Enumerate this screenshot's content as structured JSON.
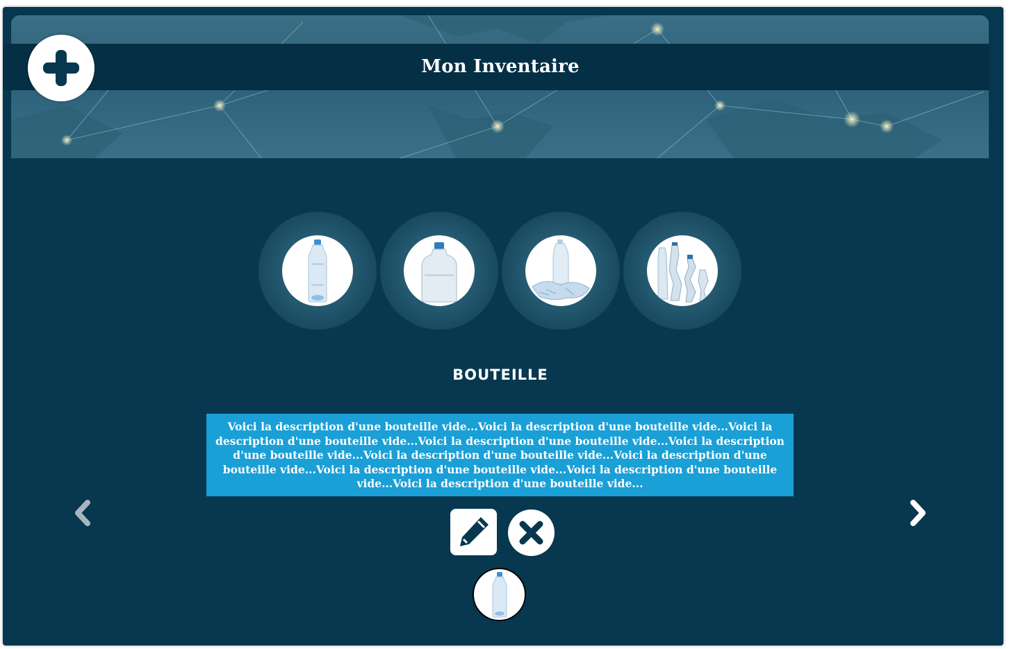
{
  "header": {
    "title": "Mon Inventaire"
  },
  "inventory": {
    "items": [
      {
        "icon": "water-bottle-icon"
      },
      {
        "icon": "large-bottle-icon"
      },
      {
        "icon": "crushed-bottles-icon"
      },
      {
        "icon": "bottle-group-icon"
      }
    ],
    "selected": {
      "name": "BOUTEILLE",
      "description": "Voici la description d'une bouteille vide...Voici la description d'une bouteille vide...Voici la description d'une bouteille vide...Voici la description d'une bouteille vide...Voici la description d'une bouteille vide...Voici la description d'une bouteille vide...Voici la description d'une bouteille vide...Voici la description d'une bouteille vide...Voici la description d'une bouteille vide...Voici la description d'une bouteille vide...",
      "icon": "water-bottle-icon"
    }
  },
  "colors": {
    "background": "#07384f",
    "title_bar": "#052f44",
    "description_bg": "#1a9fd6",
    "button_bg": "#ffffff",
    "icon_dark": "#07384f"
  }
}
